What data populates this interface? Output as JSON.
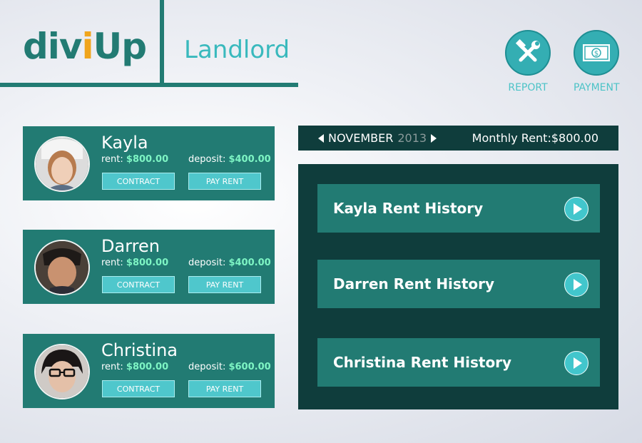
{
  "header": {
    "logo_parts": [
      "div",
      "i",
      "Up"
    ],
    "role": "Landlord",
    "actions": [
      {
        "label": "REPORT",
        "icon": "tools-icon"
      },
      {
        "label": "PAYMENT",
        "icon": "dollar-bill-icon"
      }
    ]
  },
  "tenants": [
    {
      "name": "Kayla",
      "rent_label": "rent:",
      "rent": "$800.00",
      "deposit_label": "deposit:",
      "deposit": "$400.00",
      "contract_label": "CONTRACT",
      "pay_label": "PAY RENT"
    },
    {
      "name": "Darren",
      "rent_label": "rent:",
      "rent": "$800.00",
      "deposit_label": "deposit:",
      "deposit": "$400.00",
      "contract_label": "CONTRACT",
      "pay_label": "PAY RENT"
    },
    {
      "name": "Christina",
      "rent_label": "rent:",
      "rent": "$800.00",
      "deposit_label": "deposit:",
      "deposit": "$600.00",
      "contract_label": "CONTRACT",
      "pay_label": "PAY RENT"
    }
  ],
  "period": {
    "month": "NOVEMBER",
    "year": "2013",
    "monthly_rent": "Monthly Rent:$800.00"
  },
  "history": [
    {
      "label": "Kayla Rent History"
    },
    {
      "label": "Darren Rent History"
    },
    {
      "label": "Christina Rent History"
    }
  ],
  "colors": {
    "primary": "#227b73",
    "dark": "#0f3d3c",
    "accent": "#39b9bd",
    "logo_i": "#f0a51c",
    "amount": "#7ef5c4"
  }
}
